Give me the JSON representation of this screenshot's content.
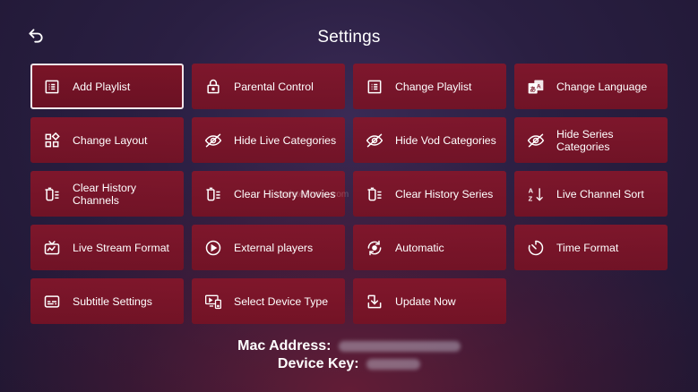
{
  "header": {
    "title": "Settings"
  },
  "tiles": [
    {
      "label": "Add Playlist",
      "icon": "list-icon"
    },
    {
      "label": "Parental Control",
      "icon": "lock-icon"
    },
    {
      "label": "Change Playlist",
      "icon": "list-icon"
    },
    {
      "label": "Change Language",
      "icon": "translate-icon"
    },
    {
      "label": "Change Layout",
      "icon": "layout-icon"
    },
    {
      "label": "Hide Live Categories",
      "icon": "eye-off-icon"
    },
    {
      "label": "Hide Vod Categories",
      "icon": "eye-off-icon"
    },
    {
      "label": "Hide Series Categories",
      "icon": "eye-off-icon"
    },
    {
      "label": "Clear History Channels",
      "icon": "clear-history-icon"
    },
    {
      "label": "Clear History Movies",
      "icon": "clear-history-icon"
    },
    {
      "label": "Clear History Series",
      "icon": "clear-history-icon"
    },
    {
      "label": "Live Channel Sort",
      "icon": "sort-az-icon"
    },
    {
      "label": "Live Stream Format",
      "icon": "tv-icon"
    },
    {
      "label": "External players",
      "icon": "play-circle-icon"
    },
    {
      "label": "Automatic",
      "icon": "auto-refresh-icon"
    },
    {
      "label": "Time Format",
      "icon": "timer-icon"
    },
    {
      "label": "Subtitle Settings",
      "icon": "subtitles-icon"
    },
    {
      "label": "Select Device Type",
      "icon": "devices-icon"
    },
    {
      "label": "Update Now",
      "icon": "download-icon"
    }
  ],
  "watermark": "UpdateStatus.com",
  "info": {
    "mac_label": "Mac Address:",
    "device_key_label": "Device Key:"
  }
}
